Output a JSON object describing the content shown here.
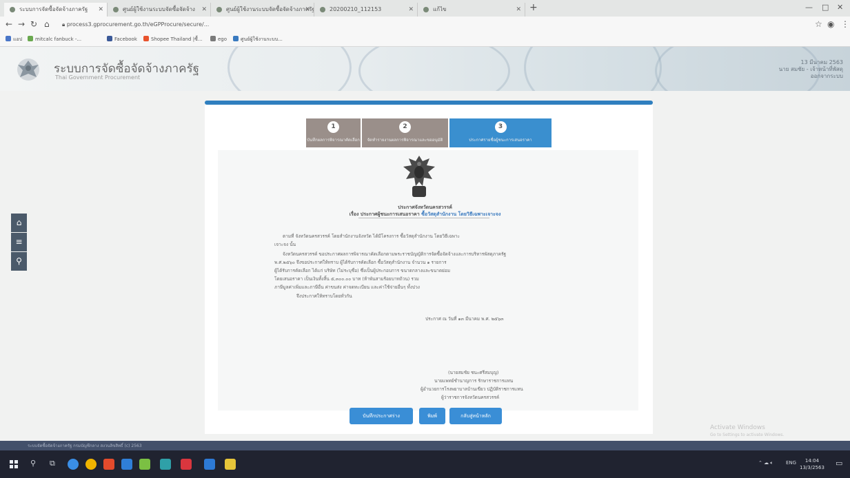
{
  "browser": {
    "tabs": [
      {
        "title": "ระบบการจัดซื้อจัดจ้างภาครัฐ"
      },
      {
        "title": "ศูนย์ผู้ใช้งานระบบจัดซื้อจัดจ้าง"
      },
      {
        "title": "ศูนย์ผู้ใช้งานระบบจัดซื้อจัดจ้างภาครัฐ"
      },
      {
        "title": "20200210_112153"
      },
      {
        "title": "แก้ไข"
      }
    ],
    "url": "process3.gprocurement.go.th/eGPProcure/secure/...",
    "bookmarks": [
      {
        "label": "แอป",
        "color": "#4a76c8"
      },
      {
        "label": "mitcalc fanbuck -...",
        "color": "#6aa84f"
      },
      {
        "label": "Facebook",
        "color": "#3b5998"
      },
      {
        "label": "Shopee Thailand |ซื้...",
        "color": "#e8532d"
      },
      {
        "label": "ego",
        "color": "#7a7a7a"
      },
      {
        "label": "ศูนย์ผู้ใช้งานระบบ...",
        "color": "#3a7abf"
      }
    ]
  },
  "header": {
    "title": "ระบบการจัดซื้อจัดจ้างภาครัฐ",
    "subtitle": "Thai Government Procurement",
    "user_line1": "13 มีนาคม 2563",
    "user_line2": "นาย สมชัย - เจ้าหน้าที่พัสดุ",
    "user_line3": "ออกจากระบบ"
  },
  "steps": [
    {
      "num": "1",
      "label": "บันทึกผลการพิจารณาคัดเลือก",
      "state": "done"
    },
    {
      "num": "2",
      "label": "จัดทำรายงานผลการพิจารณาและขออนุมัติ",
      "state": "done"
    },
    {
      "num": "3",
      "label": "ประกาศรายชื่อผู้ชนะการเสนอราคา",
      "state": "active"
    }
  ],
  "document": {
    "title1": "ประกาศจังหวัดนครสวรรค์",
    "title2_prefix": "เรื่อง ประกาศผู้ชนะการเสนอราคา",
    "title2_highlight": "ซื้อวัสดุสำนักงาน โดยวิธีเฉพาะเจาะจง",
    "lines": [
      "ตามที่ จังหวัดนครสวรรค์ โดยสำนักงานจังหวัด ได้มีโครงการ ซื้อวัสดุสำนักงาน โดยวิธีเฉพาะ",
      "เจาะจง นั้น",
      "จังหวัดนครสวรรค์ ขอประกาศผลการพิจารณาคัดเลือกตามพระราชบัญญัติการจัดซื้อจัดจ้างและการบริหารพัสดุภาครัฐ",
      "พ.ศ.๒๕๖๐ จึงขอประกาศให้ทราบ ผู้ได้รับการคัดเลือก ซื้อวัสดุสำนักงาน จำนวน ๑ รายการ",
      "ผู้ได้รับการคัดเลือก ได้แก่ บริษัท (ไม่ระบุชื่อ) ซึ่งเป็นผู้ประกอบการ ขนาดกลางและขนาดย่อม",
      "โดยเสนอราคา เป็นเงินทั้งสิ้น ๕,๓๐๐.๐๐ บาท (ห้าพันสามร้อยบาทถ้วน) รวม",
      "ภาษีมูลค่าเพิ่มและภาษีอื่น ค่าขนส่ง ค่าจดทะเบียน และค่าใช้จ่ายอื่นๆ ทั้งปวง"
    ],
    "closing": "จึงประกาศให้ทราบโดยทั่วกัน",
    "date": "ประกาศ ณ วันที่ ๑๓ มีนาคม พ.ศ. ๒๕๖๓",
    "signer_name": "(นายสมชัย ชนะศรีสมบุญ)",
    "signer_pos1": "นายแพทย์ชำนาญการ รักษาราชการแทน",
    "signer_pos2": "ผู้อำนวยการโรงพยาบาลบ้านเขียว ปฏิบัติราชการแทน",
    "signer_pos3": "ผู้ว่าราชการจังหวัดนครสวรรค์"
  },
  "buttons": {
    "save_draft": "บันทึกประกาศร่าง",
    "print": "พิมพ์",
    "back": "กลับสู่หน้าหลัก"
  },
  "watermark": {
    "line1": "Activate Windows",
    "line2": "Go to Settings to activate Windows."
  },
  "status_strip": "ระบบจัดซื้อจัดจ้างภาครัฐ กรมบัญชีกลาง สงวนลิขสิทธิ์ (c) 2563",
  "taskbar": {
    "tray_text": "ENG",
    "time": "14:04",
    "date": "13/3/2563",
    "app_colors": [
      "#3a8ee6",
      "#f0b400",
      "#e44b2c",
      "#2f7fd9",
      "#7bc043",
      "#2fa0a8",
      "#d9363e",
      "#2d7ad6",
      "#e6c53a"
    ]
  }
}
